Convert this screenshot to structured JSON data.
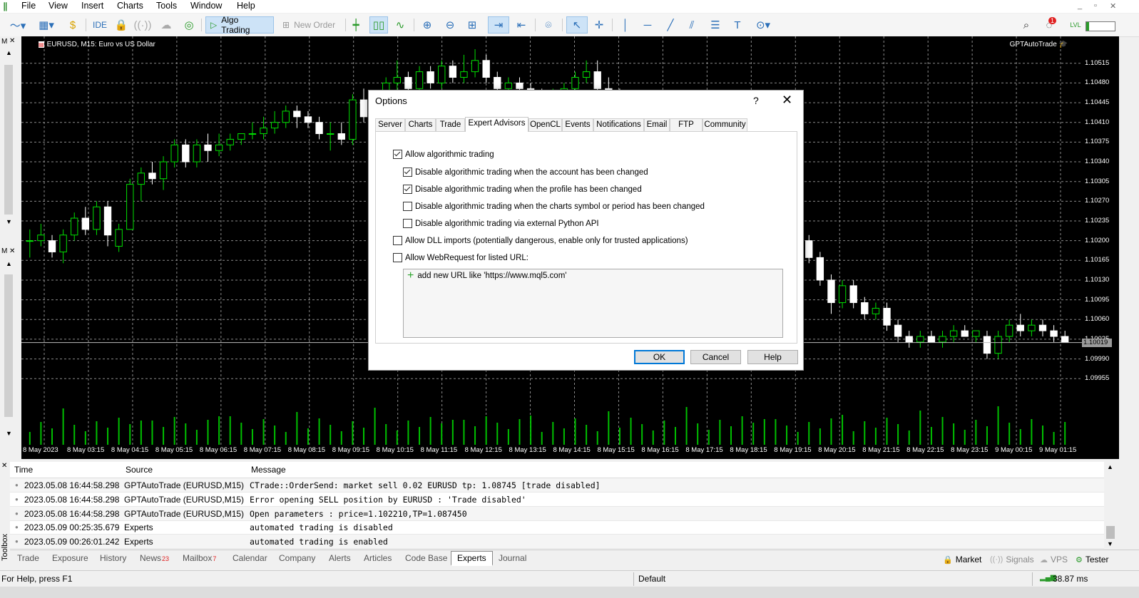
{
  "menu": {
    "items": [
      "File",
      "View",
      "Insert",
      "Charts",
      "Tools",
      "Window",
      "Help"
    ]
  },
  "toolbar": {
    "ide_label": "IDE",
    "algo_trading_label": "Algo Trading",
    "new_order_label": "New Order",
    "notification_count": "1"
  },
  "chart": {
    "title": "EURUSD, M15:  Euro vs US Dollar",
    "ea_label": "GPTAutoTrade",
    "current_price": "1.10019",
    "colors": {
      "bull": "#00e000",
      "bear": "#ffffff",
      "grid": "#8a8a8a",
      "volume": "#00c000"
    }
  },
  "chart_data": {
    "type": "candlestick",
    "price_ticks": [
      "1.10515",
      "1.10480",
      "1.10445",
      "1.10410",
      "1.10375",
      "1.10340",
      "1.10305",
      "1.10270",
      "1.10235",
      "1.10200",
      "1.10165",
      "1.10130",
      "1.10095",
      "1.10060",
      "1.10025",
      "1.09990",
      "1.09955"
    ],
    "time_ticks": [
      "8 May 2023",
      "8 May 03:15",
      "8 May 04:15",
      "8 May 05:15",
      "8 May 06:15",
      "8 May 07:15",
      "8 May 08:15",
      "8 May 09:15",
      "8 May 10:15",
      "8 May 11:15",
      "8 May 12:15",
      "8 May 13:15",
      "8 May 14:15",
      "8 May 15:15",
      "8 May 16:15",
      "8 May 17:15",
      "8 May 18:15",
      "8 May 19:15",
      "8 May 20:15",
      "8 May 21:15",
      "8 May 22:15",
      "8 May 23:15",
      "9 May 00:15",
      "9 May 01:15"
    ],
    "ylim": [
      1.0993,
      1.1054
    ],
    "candles": [
      [
        1.102,
        1.1022,
        1.1017,
        1.102
      ],
      [
        1.102,
        1.1023,
        1.1019,
        1.1021
      ],
      [
        1.102,
        1.1021,
        1.1017,
        1.1018
      ],
      [
        1.1018,
        1.1022,
        1.1016,
        1.1021
      ],
      [
        1.1021,
        1.1025,
        1.102,
        1.1024
      ],
      [
        1.1024,
        1.1026,
        1.1021,
        1.1022
      ],
      [
        1.1022,
        1.1027,
        1.1021,
        1.1026
      ],
      [
        1.1026,
        1.1027,
        1.1019,
        1.1021
      ],
      [
        1.1019,
        1.1023,
        1.1018,
        1.1022
      ],
      [
        1.1022,
        1.1031,
        1.1022,
        1.103
      ],
      [
        1.103,
        1.1033,
        1.1027,
        1.1032
      ],
      [
        1.1032,
        1.1034,
        1.103,
        1.1031
      ],
      [
        1.1031,
        1.1035,
        1.1029,
        1.1034
      ],
      [
        1.1034,
        1.1038,
        1.1033,
        1.1037
      ],
      [
        1.1037,
        1.1038,
        1.1033,
        1.1034
      ],
      [
        1.1034,
        1.1038,
        1.1033,
        1.1037
      ],
      [
        1.1037,
        1.1039,
        1.1034,
        1.1036
      ],
      [
        1.1036,
        1.1039,
        1.1035,
        1.1037
      ],
      [
        1.1037,
        1.1039,
        1.1036,
        1.1038
      ],
      [
        1.1038,
        1.1039,
        1.1037,
        1.1039
      ],
      [
        1.1039,
        1.1041,
        1.1038,
        1.1039
      ],
      [
        1.1039,
        1.1042,
        1.1038,
        1.104
      ],
      [
        1.104,
        1.1043,
        1.1039,
        1.1041
      ],
      [
        1.1041,
        1.1044,
        1.104,
        1.1043
      ],
      [
        1.1043,
        1.1044,
        1.104,
        1.1042
      ],
      [
        1.1042,
        1.1043,
        1.104,
        1.1041
      ],
      [
        1.1041,
        1.1042,
        1.1038,
        1.1039
      ],
      [
        1.1039,
        1.1041,
        1.1036,
        1.1039
      ],
      [
        1.1039,
        1.1041,
        1.1037,
        1.1038
      ],
      [
        1.1038,
        1.1046,
        1.1037,
        1.1045
      ],
      [
        1.1045,
        1.1047,
        1.1041,
        1.1042
      ],
      [
        1.1042,
        1.1046,
        1.104,
        1.1043
      ],
      [
        1.1043,
        1.1049,
        1.1042,
        1.1048
      ],
      [
        1.1048,
        1.1052,
        1.1046,
        1.1049
      ],
      [
        1.1049,
        1.105,
        1.1045,
        1.1047
      ],
      [
        1.1047,
        1.1051,
        1.1046,
        1.105
      ],
      [
        1.105,
        1.1051,
        1.1047,
        1.1048
      ],
      [
        1.1048,
        1.1052,
        1.1047,
        1.1051
      ],
      [
        1.1051,
        1.1052,
        1.1048,
        1.1049
      ],
      [
        1.1049,
        1.1053,
        1.1048,
        1.105
      ],
      [
        1.105,
        1.1054,
        1.1049,
        1.1052
      ],
      [
        1.1052,
        1.1053,
        1.1048,
        1.1049
      ],
      [
        1.1049,
        1.105,
        1.1046,
        1.1047
      ],
      [
        1.1047,
        1.1049,
        1.1045,
        1.1048
      ],
      [
        1.1048,
        1.1049,
        1.1046,
        1.1047
      ],
      [
        1.1047,
        1.1048,
        1.1045,
        1.1046
      ],
      [
        1.1046,
        1.1047,
        1.1044,
        1.1045
      ],
      [
        1.1045,
        1.1047,
        1.1044,
        1.1046
      ],
      [
        1.1046,
        1.1048,
        1.1045,
        1.1047
      ],
      [
        1.1047,
        1.105,
        1.1046,
        1.1049
      ],
      [
        1.1049,
        1.1052,
        1.1048,
        1.105
      ],
      [
        1.105,
        1.1052,
        1.1046,
        1.1047
      ],
      [
        1.1047,
        1.1049,
        1.1045,
        1.1046
      ],
      [
        1.1046,
        1.1047,
        1.1043,
        1.1044
      ],
      [
        1.1044,
        1.1045,
        1.104,
        1.1041
      ],
      [
        1.1041,
        1.1042,
        1.1037,
        1.1038
      ],
      [
        1.1038,
        1.1039,
        1.1034,
        1.1035
      ],
      [
        1.1035,
        1.1036,
        1.1031,
        1.1032
      ],
      [
        1.1032,
        1.1033,
        1.1029,
        1.103
      ],
      [
        1.103,
        1.1031,
        1.1027,
        1.1028
      ],
      [
        1.1028,
        1.1029,
        1.1025,
        1.1026
      ],
      [
        1.1026,
        1.1027,
        1.1024,
        1.1025
      ],
      [
        1.1025,
        1.1026,
        1.1023,
        1.1024
      ],
      [
        1.1024,
        1.1025,
        1.1022,
        1.1023
      ],
      [
        1.1023,
        1.1027,
        1.1022,
        1.1026
      ],
      [
        1.1026,
        1.1028,
        1.1025,
        1.1027
      ],
      [
        1.1027,
        1.1029,
        1.1026,
        1.1028
      ],
      [
        1.1028,
        1.1029,
        1.1026,
        1.1027
      ],
      [
        1.1027,
        1.1028,
        1.1023,
        1.1024
      ],
      [
        1.1024,
        1.1025,
        1.1019,
        1.102
      ],
      [
        1.102,
        1.1021,
        1.1016,
        1.1017
      ],
      [
        1.1017,
        1.1018,
        1.1012,
        1.1013
      ],
      [
        1.1013,
        1.1014,
        1.1007,
        1.1009
      ],
      [
        1.1009,
        1.1013,
        1.1008,
        1.1012
      ],
      [
        1.1012,
        1.1013,
        1.1008,
        1.1009
      ],
      [
        1.1009,
        1.101,
        1.1006,
        1.1007
      ],
      [
        1.1007,
        1.1009,
        1.1006,
        1.1008
      ],
      [
        1.1008,
        1.1009,
        1.1004,
        1.1005
      ],
      [
        1.1005,
        1.1006,
        1.1002,
        1.1003
      ],
      [
        1.1003,
        1.1004,
        1.1001,
        1.1002
      ],
      [
        1.1002,
        1.1004,
        1.1001,
        1.1003
      ],
      [
        1.1003,
        1.1004,
        1.1002,
        1.1002
      ],
      [
        1.1002,
        1.1004,
        1.1001,
        1.1003
      ],
      [
        1.1003,
        1.1005,
        1.1002,
        1.1004
      ],
      [
        1.1004,
        1.1005,
        1.1003,
        1.1003
      ],
      [
        1.1003,
        1.1004,
        1.1002,
        1.1004
      ],
      [
        1.1003,
        1.1004,
        1.0999,
        1.1
      ],
      [
        1.1,
        1.1004,
        1.0999,
        1.1003
      ],
      [
        1.1003,
        1.1006,
        1.1002,
        1.1005
      ],
      [
        1.1005,
        1.1007,
        1.1003,
        1.1004
      ],
      [
        1.1004,
        1.1006,
        1.1003,
        1.1005
      ],
      [
        1.1005,
        1.1006,
        1.1003,
        1.1004
      ],
      [
        1.1004,
        1.1005,
        1.1002,
        1.1003
      ],
      [
        1.1003,
        1.1004,
        1.1002,
        1.1002
      ]
    ],
    "volume_visible": true
  },
  "dialog": {
    "title": "Options",
    "help_symbol": "?",
    "close_symbol": "✕",
    "tabs": [
      "Server",
      "Charts",
      "Trade",
      "Expert Advisors",
      "OpenCL",
      "Events",
      "Notifications",
      "Email",
      "FTP",
      "Community"
    ],
    "active_tab": "Expert Advisors",
    "options": [
      {
        "label": "Allow algorithmic trading",
        "checked": true
      },
      {
        "label": "Disable algorithmic trading when the account has been changed",
        "checked": true
      },
      {
        "label": "Disable algorithmic trading when the profile has been changed",
        "checked": true
      },
      {
        "label": "Disable algorithmic trading when the charts symbol or period has been changed",
        "checked": false
      },
      {
        "label": "Disable algorithmic trading via external Python API",
        "checked": false
      },
      {
        "label": "Allow DLL imports (potentially dangerous, enable only for trusted applications)",
        "checked": false
      },
      {
        "label": "Allow WebRequest for listed URL:",
        "checked": false
      }
    ],
    "url_placeholder": "add new URL like 'https://www.mql5.com'",
    "buttons": {
      "ok": "OK",
      "cancel": "Cancel",
      "help": "Help"
    }
  },
  "log": {
    "headers": {
      "time": "Time",
      "source": "Source",
      "message": "Message"
    },
    "rows": [
      {
        "time": "2023.05.08 16:44:58.298",
        "source": "GPTAutoTrade (EURUSD,M15)",
        "message": "CTrade::OrderSend: market sell 0.02 EURUSD tp: 1.08745 [trade disabled]"
      },
      {
        "time": "2023.05.08 16:44:58.298",
        "source": "GPTAutoTrade (EURUSD,M15)",
        "message": "Error opening SELL position by EURUSD : 'Trade disabled'"
      },
      {
        "time": "2023.05.08 16:44:58.298",
        "source": "GPTAutoTrade (EURUSD,M15)",
        "message": "Open parameters : price=1.102210,TP=1.087450"
      },
      {
        "time": "2023.05.09 00:25:35.679",
        "source": "Experts",
        "message": "automated trading is disabled"
      },
      {
        "time": "2023.05.09 00:26:01.242",
        "source": "Experts",
        "message": "automated trading is enabled"
      }
    ]
  },
  "bottom_tabs": {
    "items": [
      {
        "label": "Trade",
        "badge": ""
      },
      {
        "label": "Exposure",
        "badge": ""
      },
      {
        "label": "History",
        "badge": ""
      },
      {
        "label": "News",
        "badge": "23"
      },
      {
        "label": "Mailbox",
        "badge": "7"
      },
      {
        "label": "Calendar",
        "badge": ""
      },
      {
        "label": "Company",
        "badge": ""
      },
      {
        "label": "Alerts",
        "badge": ""
      },
      {
        "label": "Articles",
        "badge": ""
      },
      {
        "label": "Code Base",
        "badge": ""
      },
      {
        "label": "Experts",
        "badge": ""
      },
      {
        "label": "Journal",
        "badge": ""
      }
    ],
    "active": "Experts",
    "right": {
      "market": "Market",
      "signals": "Signals",
      "vps": "VPS",
      "tester": "Tester"
    },
    "toolbox_label": "Toolbox"
  },
  "statusbar": {
    "help_text": "For Help, press F1",
    "profile": "Default",
    "ping": "38.87 ms"
  }
}
